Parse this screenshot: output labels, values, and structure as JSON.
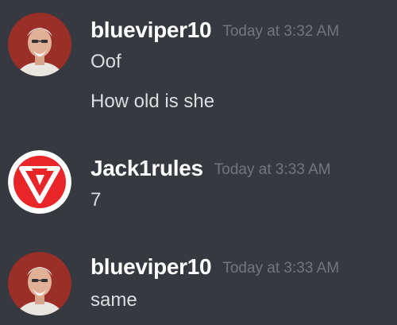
{
  "messages": [
    {
      "author": "blueviper10",
      "timestamp": "Today at 3:32 AM",
      "avatar_icon": "old-man-avatar",
      "lines": [
        "Oof",
        "How old is she"
      ]
    },
    {
      "author": "Jack1rules",
      "timestamp": "Today at 3:33 AM",
      "avatar_icon": "red-triangle-logo-avatar",
      "lines": [
        "7"
      ]
    },
    {
      "author": "blueviper10",
      "timestamp": "Today at 3:33 AM",
      "avatar_icon": "old-man-avatar",
      "lines": [
        "same"
      ]
    }
  ],
  "colors": {
    "background": "#36393f",
    "username": "#ffffff",
    "timestamp": "#72767d",
    "message_text": "#dcddde",
    "logo_red": "#e8262a"
  }
}
